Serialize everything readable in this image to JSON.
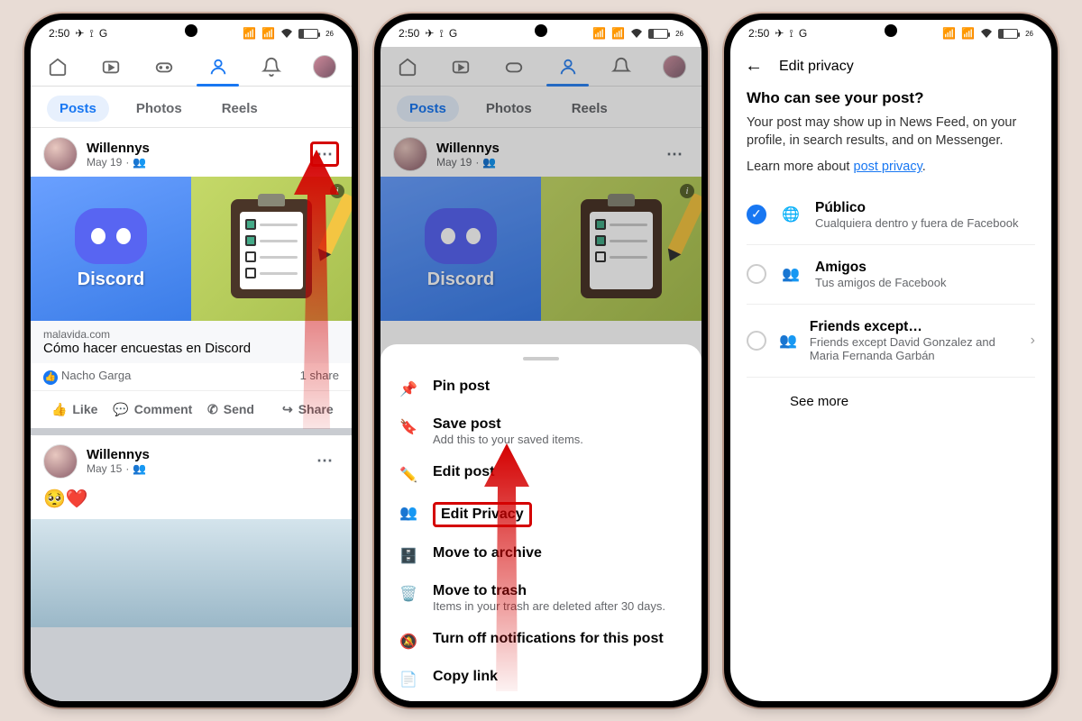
{
  "status": {
    "time": "2:50",
    "battery": "26"
  },
  "tabs": {
    "posts": "Posts",
    "photos": "Photos",
    "reels": "Reels"
  },
  "post1": {
    "name": "Willennys",
    "date": "May 19",
    "discord": "Discord",
    "link_src": "malavida.com",
    "link_title": "Cómo hacer encuestas en Discord",
    "reactor": "Nacho Garga",
    "shares": "1 share"
  },
  "actions": {
    "like": "Like",
    "comment": "Comment",
    "send": "Send",
    "share": "Share"
  },
  "post2": {
    "name": "Willennys",
    "date": "May 15"
  },
  "sheet": {
    "pin": "Pin post",
    "save": "Save post",
    "save_sub": "Add this to your saved items.",
    "edit": "Edit post",
    "privacy": "Edit Privacy",
    "archive": "Move to archive",
    "trash": "Move to trash",
    "trash_sub": "Items in your trash are deleted after 30 days.",
    "notify": "Turn off notifications for this post",
    "copy": "Copy link"
  },
  "privacy": {
    "header": "Edit privacy",
    "title": "Who can see your post?",
    "desc": "Your post may show up in News Feed, on your profile, in search results, and on Messenger.",
    "learn_pre": "Learn more about ",
    "learn_link": "post privacy",
    "opts": {
      "public_t": "Público",
      "public_s": "Cualquiera dentro y fuera de Facebook",
      "friends_t": "Amigos",
      "friends_s": "Tus amigos de Facebook",
      "except_t": "Friends except…",
      "except_s": "Friends except David Gonzalez and Maria Fernanda Garbán"
    },
    "seemore": "See more"
  }
}
